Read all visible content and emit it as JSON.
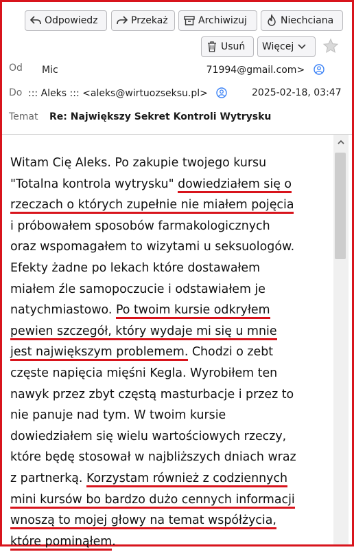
{
  "toolbar": {
    "reply_label": "Odpowiedz",
    "forward_label": "Przekaż",
    "archive_label": "Archiwizuj",
    "junk_label": "Niechciana",
    "delete_label": "Usuń",
    "more_label": "Więcej"
  },
  "header": {
    "from_label": "Od",
    "from_value_start": "Mic",
    "from_value_end": "71994@gmail.com>",
    "to_label": "Do",
    "to_value": "::: Aleks ::: <aleks@wirtuozseksu.pl>",
    "date": "2025-02-18, 03:47",
    "subject_label": "Temat",
    "subject": "Re: Największy Sekret Kontroli Wytrysku"
  },
  "body": {
    "l1": "Witam Cię Aleks. Po zakupie twojego kursu",
    "l2a": "\"Totalna kontrola wytrysku\" ",
    "l2b": "dowiedziałem się o",
    "l3": "rzeczach o których zupełnie nie miałem pojęcia",
    "l4": "i próbowałem sposobów farmakologicznych",
    "l5": "oraz wspomagałem to wizytami u seksuologów.",
    "l6": "Efekty żadne po lekach które dostawałem",
    "l7": "miałem źle samopoczucie i odstawiałem je",
    "l8a": "natychmiastowo. ",
    "l8b": "Po twoim kursie odkryłem",
    "l9": "pewien szczegół, który wydaje mi się u mnie",
    "l10a": "jest największym problemem.",
    "l10b": " Chodzi o zebt",
    "l11": "częste napięcia mięśni Kegla. Wyrobiłem ten",
    "l12": "nawyk przez zbyt częstą masturbacje i przez to",
    "l13": "nie panuje nad tym. W twoim kursie",
    "l14": "dowiedziałem się wielu wartościowych rzeczy,",
    "l15": "które będę stosował w najbliższych dniach wraz",
    "l16a": "z partnerką. ",
    "l16b": "Korzystam również z codziennych",
    "l17": "mini kursów bo bardzo dużo cennych informacji",
    "l18": "wnoszą to mojej głowy na temat współżycia,",
    "l19a": "które pominąłem",
    "l19b": "."
  },
  "icons": {
    "reply": "reply-arrow-icon",
    "forward": "forward-arrow-icon",
    "archive": "archive-box-icon",
    "junk": "flame-icon",
    "delete": "trash-icon",
    "more": "chevron-down-icon",
    "star": "star-icon",
    "contact": "person-icon"
  },
  "colors": {
    "highlight": "#d8141c",
    "accent": "#3b82f6"
  }
}
